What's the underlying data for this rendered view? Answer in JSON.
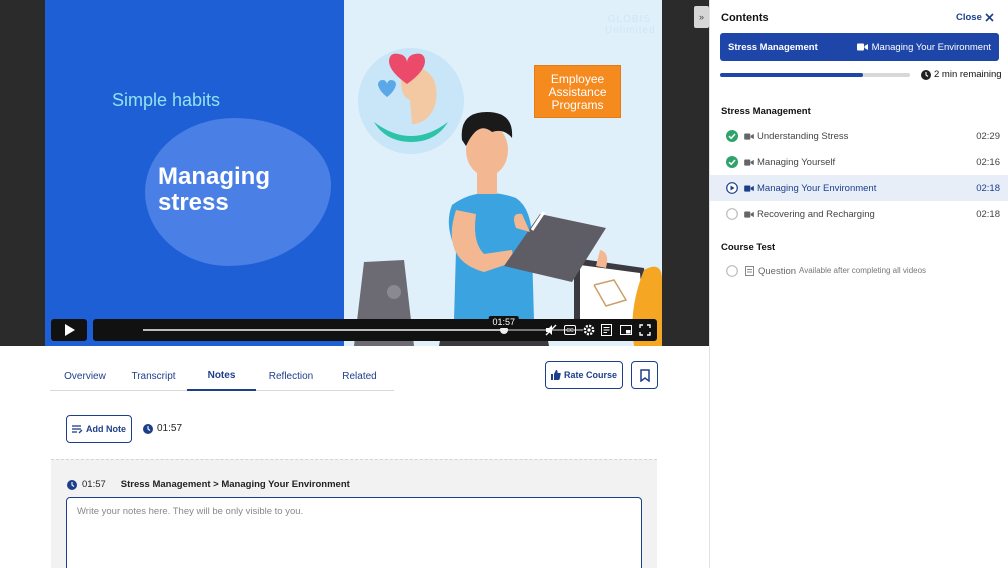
{
  "video": {
    "slide": {
      "eyebrow": "Simple habits",
      "title": "Managing stress",
      "watermark": "GLOBIS Unlimited",
      "callout": "Employee Assistance Programs"
    },
    "player": {
      "current_time": "01:57",
      "progress": 0.82
    }
  },
  "tabs": [
    {
      "label": "Overview",
      "active": false
    },
    {
      "label": "Transcript",
      "active": false
    },
    {
      "label": "Notes",
      "active": true
    },
    {
      "label": "Reflection",
      "active": false
    },
    {
      "label": "Related",
      "active": false
    }
  ],
  "actions": {
    "rate_label": "Rate Course",
    "add_note_label": "Add Note",
    "note_time": "01:57"
  },
  "note_editor": {
    "time": "01:57",
    "path": "Stress Management > Managing Your Environment",
    "placeholder": "Write your notes here. They will be only visible to you."
  },
  "sidebar": {
    "title": "Contents",
    "close_label": "Close",
    "now_playing": {
      "course": "Stress Management",
      "lesson": "Managing Your Environment"
    },
    "progress": 0.75,
    "remaining": "2 min remaining",
    "sections": [
      {
        "title": "Stress Management",
        "lessons": [
          {
            "title": "Understanding Stress",
            "duration": "02:29",
            "status": "done"
          },
          {
            "title": "Managing Yourself",
            "duration": "02:16",
            "status": "done"
          },
          {
            "title": "Managing Your Environment",
            "duration": "02:18",
            "status": "current"
          },
          {
            "title": "Recovering and Recharging",
            "duration": "02:18",
            "status": "todo"
          }
        ]
      },
      {
        "title": "Course Test",
        "question_label": "Question",
        "question_hint": "Available after completing all videos"
      }
    ]
  },
  "colors": {
    "brand_navy": "#1d3f8a",
    "accent_blue": "#1e46a8",
    "done_green": "#2ea36b",
    "slide_blue": "#1f5fd6",
    "callout_orange": "#f58a1f"
  }
}
